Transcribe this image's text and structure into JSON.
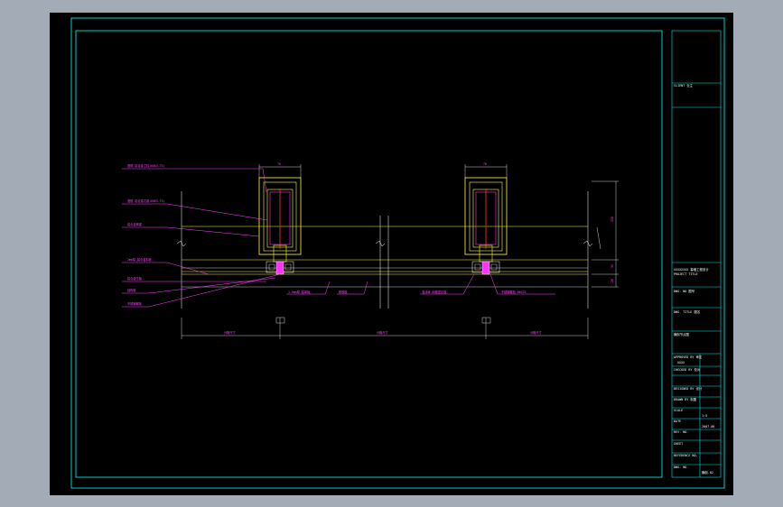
{
  "title_block": {
    "client": "CLIENT 业主",
    "project": "XXXXXXXX 幕墙工程设计",
    "project_sub": "PROJECT TITLE",
    "drawing_no": "DWG. NO 图号",
    "drawing_title": "DWG. TITLE 图名",
    "drawing_title_value": "横剖节点图",
    "approved_by": "APPROVED BY 审定",
    "approved_value": "XXXX",
    "checked_by": "CHECKED BY 校对",
    "designed_by": "DESIGNED BY 设计",
    "drawn_by": "DRAWN BY 制图",
    "scale": "SCALE",
    "scale_value": "1:5",
    "date": "DATE",
    "date_value": "2007.06",
    "rev_no": "REV. NO.",
    "sheet": "SHEET",
    "ref_no": "REFERENCE NO.",
    "drawing_no_value": "DWG. NO.",
    "drawing_code": "横剖-02"
  },
  "annotations": {
    "left": [
      "竖框 铝合金立柱(6063-T5)",
      "竖框 铝合金芯套(6063-T5)",
      "铝合金横梁",
      "2mm厚 铝合金扣板",
      "铝合金压板",
      "结构胶",
      "不锈钢螺栓"
    ],
    "bottom": [
      "1.5mm厚 铝单板",
      "耐候胶",
      "泡沫棒 耐候密封胶",
      "不锈钢螺栓 M6X25"
    ],
    "dims": [
      "分格尺寸",
      "分格尺寸",
      "分格尺寸"
    ],
    "mullion_w": "70",
    "depth": "150",
    "gap": "15",
    "side": "20"
  },
  "colors": {
    "sheet": "#000000",
    "border": "#00e5e5",
    "mullion": "#ffff33",
    "glass": "#ff33ff",
    "center": "#ff3333",
    "text": "#ff44ff",
    "white": "#ffffff"
  }
}
